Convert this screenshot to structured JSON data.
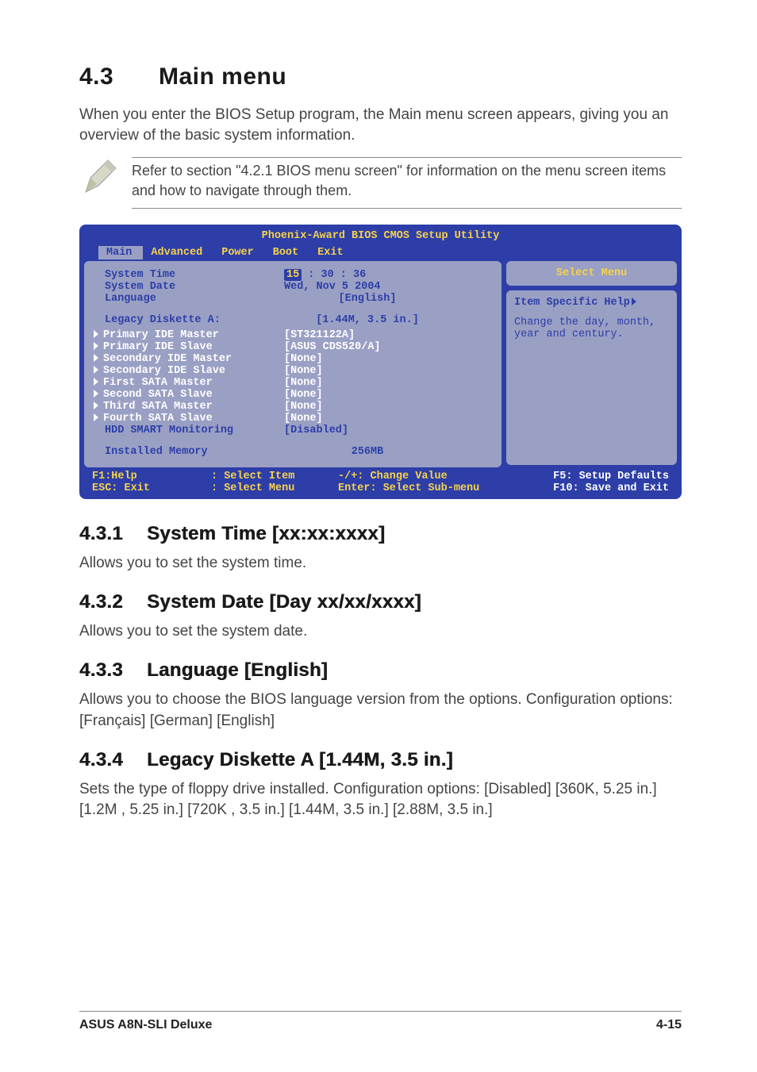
{
  "section": {
    "num": "4.3",
    "title": "Main menu"
  },
  "intro": "When you enter the BIOS Setup program, the Main menu screen appears, giving you an overview of the basic system information.",
  "note": "Refer to section \"4.2.1  BIOS menu screen\" for information on the menu screen items and how to navigate through them.",
  "bios": {
    "title": "Phoenix-Award BIOS CMOS Setup Utility",
    "tabs": [
      "Main",
      "Advanced",
      "Power",
      "Boot",
      "Exit"
    ],
    "selected_tab": "Main",
    "items": {
      "system_time_label": "System Time",
      "system_time_value_hour": "15",
      "system_time_value_rest": " : 30 : 36",
      "system_date_label": "System Date",
      "system_date_value": "Wed, Nov 5 2004",
      "language_label": "Language",
      "language_value": "[English]",
      "legacy_label": "Legacy Diskette A:",
      "legacy_value": "[1.44M, 3.5 in.]",
      "pim_label": "Primary IDE Master",
      "pim_value": "[ST321122A]",
      "pis_label": "Primary IDE Slave",
      "pis_value": "[ASUS CDS520/A]",
      "sim_label": "Secondary IDE Master",
      "sim_value": "[None]",
      "sis_label": "Secondary IDE Slave",
      "sis_value": "[None]",
      "s1_label": "First SATA Master",
      "s1_value": "[None]",
      "s2_label": "Second SATA Slave",
      "s2_value": "[None]",
      "s3_label": "Third SATA Master",
      "s3_value": "[None]",
      "s4_label": "Fourth SATA Slave",
      "s4_value": "[None]",
      "hdd_label": "HDD SMART Monitoring",
      "hdd_value": "[Disabled]",
      "mem_label": "Installed Memory",
      "mem_value": "256MB"
    },
    "rightbox": {
      "select_menu": "Select Menu",
      "help_title": "Item Specific Help",
      "help_text": "Change the day, month, year and century."
    },
    "footer": {
      "f1": "F1:Help",
      "esc": "ESC: Exit",
      "sel_item": ": Select Item",
      "sel_menu": ": Select Menu",
      "change": "-/+: Change Value",
      "enter": "Enter: Select Sub-menu",
      "f5": "F5: Setup Defaults",
      "f10": "F10: Save and Exit"
    }
  },
  "subs": {
    "s1": {
      "num": "4.3.1",
      "title": "System Time [xx:xx:xxxx]",
      "body": "Allows you to set the system time."
    },
    "s2": {
      "num": "4.3.2",
      "title": "System Date [Day xx/xx/xxxx]",
      "body": "Allows you to set the system date."
    },
    "s3": {
      "num": "4.3.3",
      "title": "Language [English]",
      "body": "Allows you to choose the BIOS language version from the options. Configuration options: [Français] [German] [English]"
    },
    "s4": {
      "num": "4.3.4",
      "title": "Legacy Diskette A [1.44M, 3.5 in.]",
      "body": "Sets the type of floppy drive installed. Configuration options: [Disabled] [360K, 5.25 in.] [1.2M , 5.25 in.] [720K , 3.5 in.] [1.44M, 3.5 in.] [2.88M, 3.5 in.]"
    }
  },
  "footer": {
    "left": "ASUS A8N-SLI Deluxe",
    "right": "4-15"
  }
}
